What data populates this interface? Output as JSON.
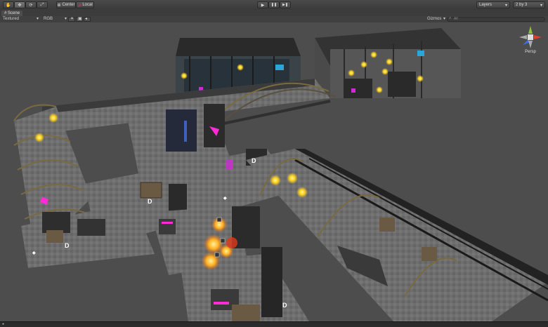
{
  "toolbar": {
    "tools": [
      {
        "name": "hand-tool-button",
        "icon": "hand-icon",
        "glyph": "✋"
      },
      {
        "name": "move-tool-button",
        "icon": "move-icon",
        "glyph": "✥"
      },
      {
        "name": "rotate-tool-button",
        "icon": "rotate-icon",
        "glyph": "⟳"
      },
      {
        "name": "scale-tool-button",
        "icon": "scale-icon",
        "glyph": "⤢"
      }
    ],
    "pivot_label": "Center",
    "space_label": "Local",
    "play_glyph": "▶",
    "pause_glyph": "❚❚",
    "step_glyph": "▶❚",
    "layers_label": "Layers",
    "layout_label": "2 by 3"
  },
  "tab": {
    "label": "Scene"
  },
  "scenebar": {
    "draw_mode": "Textured",
    "render_mode": "RGB",
    "gizmos_label": "Gizmos",
    "search_placeholder": "All"
  },
  "gizmo": {
    "projection_label": "Persp",
    "colors": {
      "x": "#e0402a",
      "y": "#8ac23b",
      "z": "#3a70e0"
    }
  },
  "colors": {
    "background": "#4d4d4d",
    "accent_light": "#ffd21a",
    "accent_magenta": "#ff2bd6"
  }
}
